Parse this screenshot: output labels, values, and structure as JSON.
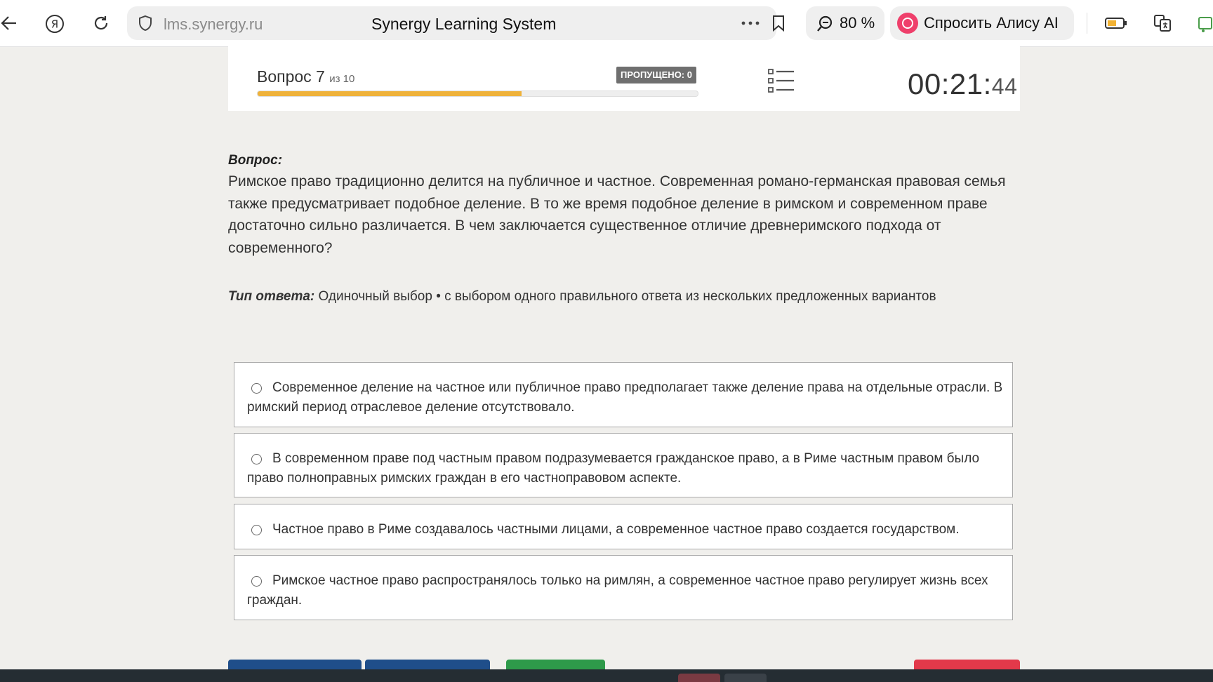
{
  "browser": {
    "url": "lms.synergy.ru",
    "page_title": "Synergy Learning System",
    "zoom": "80 %",
    "alice_label": "Спросить Алису AI"
  },
  "header": {
    "question_label": "Вопрос 7",
    "question_of": "из 10",
    "skipped_badge": "ПРОПУЩЕНО: 0",
    "progress_fraction": 0.6,
    "timer_hm": "00:21:",
    "timer_s": "44"
  },
  "question": {
    "label": "Вопрос:",
    "text": "Римское право традиционно делится на публичное и частное. Современная романо-германская правовая семья также предусматривает подобное деление. В то же время подобное деление в римском и современном праве достаточно сильно различается. В чем заключается существенное отличие древнеримского подхода от современного?",
    "answer_type_label": "Тип ответа:",
    "answer_type_value": "Одиночный выбор • с выбором одного правильного ответа из нескольких предложенных вариантов"
  },
  "options": [
    {
      "text": "Современное деление на частное или публичное право предполагает также деление права на отдельные отрасли. В римский период отраслевое деление отсутствовало."
    },
    {
      "text": "В современном праве под частным правом подразумевается гражданское право, а в Риме частным правом было право полноправных римских граждан в его частноправовом аспекте."
    },
    {
      "text": "Частное право в Риме создавалось частными лицами, а современное частное право создается государством."
    },
    {
      "text": "Римское частное право распространялось только на римлян, а современное частное право регулирует жизнь всех граждан."
    }
  ],
  "colors": {
    "progress": "#efb23a",
    "btn_blue": "#1f4e8a",
    "btn_green": "#2e9a4a",
    "btn_red": "#e2394a"
  }
}
